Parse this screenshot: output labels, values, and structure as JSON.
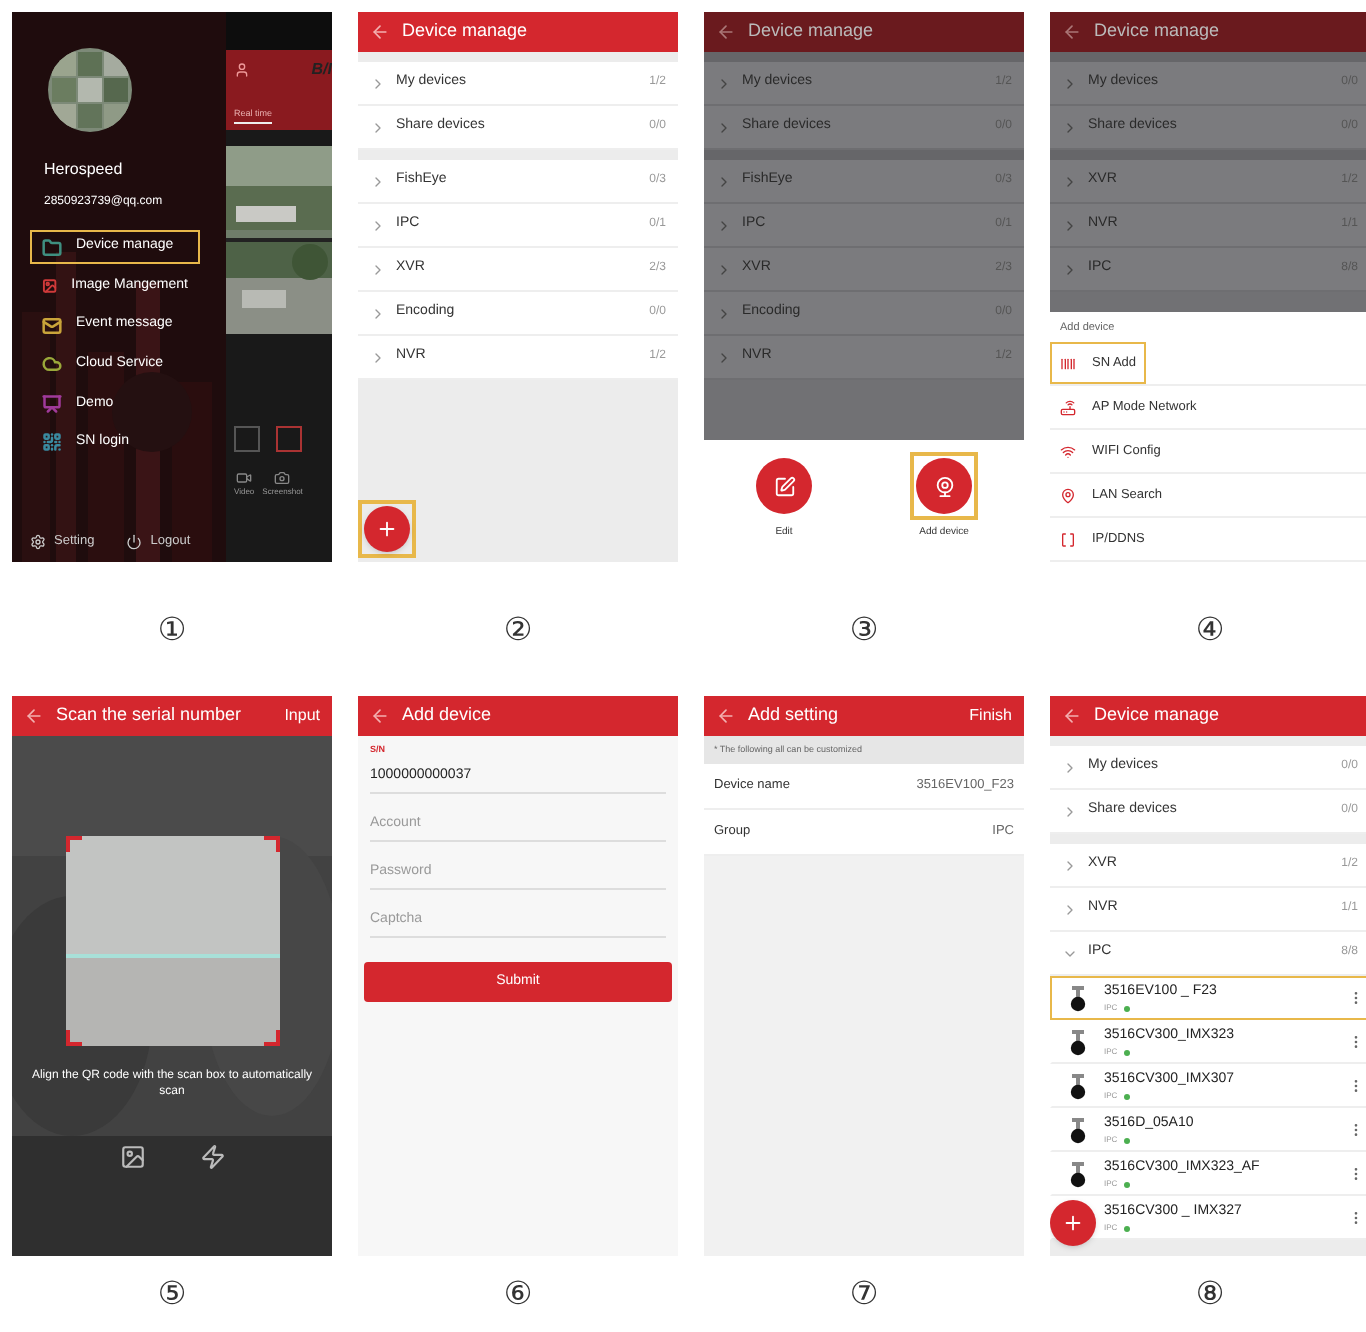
{
  "panels": [
    {
      "kind": "drawer",
      "number": "①",
      "profile": {
        "name": "Herospeed",
        "email": "2850923739@qq.com"
      },
      "menu": [
        {
          "label": "Device manage",
          "selected": true,
          "color": "#3f8f80"
        },
        {
          "label": "Image Mangement",
          "selected": false,
          "color": "#d03a3a"
        },
        {
          "label": "Event message",
          "selected": false,
          "color": "#c9a43a"
        },
        {
          "label": "Cloud Service",
          "selected": false,
          "color": "#9aa83a"
        },
        {
          "label": "Demo",
          "selected": false,
          "color": "#a03a9a"
        },
        {
          "label": "SN login",
          "selected": false,
          "color": "#3a8aa0"
        }
      ],
      "footer": [
        "Setting",
        "Logout"
      ],
      "backdrop": {
        "brand": "B/I",
        "tab": "Real time",
        "tools": [
          "Video",
          "Screenshot"
        ]
      }
    },
    {
      "kind": "device_list",
      "number": "②",
      "title": "Device manage",
      "dimmed": false,
      "groups": [
        [
          {
            "label": "My devices",
            "count": "1/2"
          },
          {
            "label": "Share devices",
            "count": "0/0"
          }
        ],
        [
          {
            "label": "FishEye",
            "count": "0/3"
          },
          {
            "label": "IPC",
            "count": "0/1"
          },
          {
            "label": "XVR",
            "count": "2/3"
          },
          {
            "label": "Encoding",
            "count": "0/0"
          },
          {
            "label": "NVR",
            "count": "1/2"
          }
        ]
      ],
      "fab": {
        "highlighted": true
      }
    },
    {
      "kind": "device_list_actions",
      "number": "③",
      "title": "Device manage",
      "dimmed": true,
      "groups": [
        [
          {
            "label": "My devices",
            "count": "1/2"
          },
          {
            "label": "Share devices",
            "count": "0/0"
          }
        ],
        [
          {
            "label": "FishEye",
            "count": "0/3"
          },
          {
            "label": "IPC",
            "count": "0/1"
          },
          {
            "label": "XVR",
            "count": "2/3"
          },
          {
            "label": "Encoding",
            "count": "0/0"
          },
          {
            "label": "NVR",
            "count": "1/2"
          }
        ]
      ],
      "actions": [
        {
          "label": "Edit",
          "highlighted": false
        },
        {
          "label": "Add device",
          "highlighted": true
        }
      ]
    },
    {
      "kind": "device_list_sheet",
      "number": "④",
      "title": "Device manage",
      "dimmed": true,
      "groups": [
        [
          {
            "label": "My devices",
            "count": "0/0"
          },
          {
            "label": "Share devices",
            "count": "0/0"
          }
        ],
        [
          {
            "label": "XVR",
            "count": "1/2"
          },
          {
            "label": "NVR",
            "count": "1/1"
          },
          {
            "label": "IPC",
            "count": "8/8"
          }
        ]
      ],
      "sheet": {
        "title": "Add device",
        "options": [
          {
            "label": "SN Add",
            "highlighted": true
          },
          {
            "label": "AP Mode Network",
            "highlighted": false
          },
          {
            "label": "WIFI Config",
            "highlighted": false
          },
          {
            "label": "LAN Search",
            "highlighted": false
          },
          {
            "label": "IP/DDNS",
            "highlighted": false
          }
        ]
      }
    },
    {
      "kind": "scanner",
      "number": "⑤",
      "title": "Scan the serial number",
      "action": "Input",
      "hint": "Align the QR code with the scan box to automatically scan"
    },
    {
      "kind": "form",
      "number": "⑥",
      "title": "Add device",
      "fields": [
        {
          "label": "S/N",
          "value": "1000000000037"
        },
        {
          "placeholder": "Account"
        },
        {
          "placeholder": "Password"
        },
        {
          "placeholder": "Captcha"
        }
      ],
      "submit": "Submit"
    },
    {
      "kind": "settings",
      "number": "⑦",
      "title": "Add setting",
      "action": "Finish",
      "note": "* The following all can be customized",
      "rows": [
        {
          "label": "Device name",
          "value": "3516EV100_F23"
        },
        {
          "label": "Group",
          "value": "IPC"
        }
      ]
    },
    {
      "kind": "device_tree",
      "number": "⑧",
      "title": "Device manage",
      "dimmed": false,
      "groups": [
        [
          {
            "label": "My devices",
            "count": "0/0",
            "expanded": false
          },
          {
            "label": "Share devices",
            "count": "0/0",
            "expanded": false
          }
        ],
        [
          {
            "label": "XVR",
            "count": "1/2",
            "expanded": false
          },
          {
            "label": "NVR",
            "count": "1/1",
            "expanded": false
          },
          {
            "label": "IPC",
            "count": "8/8",
            "expanded": true
          }
        ]
      ],
      "devices": [
        {
          "name": "3516EV100 _ F23",
          "type": "IPC",
          "color": "#4caf50",
          "selected": true
        },
        {
          "name": "3516CV300_IMX323",
          "type": "IPC",
          "color": "#4caf50",
          "selected": false
        },
        {
          "name": "3516CV300_IMX307",
          "type": "IPC",
          "color": "#4caf50",
          "selected": false
        },
        {
          "name": "3516D_05A10",
          "type": "IPC",
          "color": "#4caf50",
          "selected": false
        },
        {
          "name": "3516CV300_IMX323_AF",
          "type": "IPC",
          "color": "#4caf50",
          "selected": false
        },
        {
          "name": "3516CV300 _ IMX327",
          "type": "IPC",
          "color": "#4caf50",
          "selected": false
        }
      ],
      "fab": {
        "highlighted": false
      }
    }
  ]
}
